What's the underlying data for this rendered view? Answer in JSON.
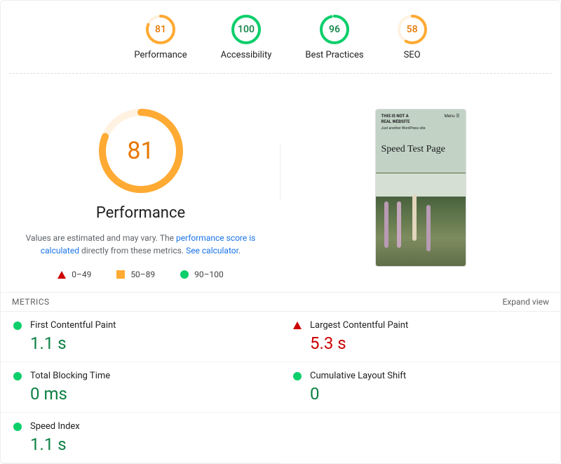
{
  "colors": {
    "fail": "#cc0000",
    "average": "#fa3",
    "pass": "#0cce6b",
    "averageText": "#c33300",
    "averageScore": "#e67700",
    "averageBg": "#fff7e6",
    "passBg": "#e6faef",
    "passText": "#0b8043"
  },
  "categories": [
    {
      "id": "performance",
      "label": "Performance",
      "score": 81,
      "level": "average"
    },
    {
      "id": "accessibility",
      "label": "Accessibility",
      "score": 100,
      "level": "pass"
    },
    {
      "id": "best-practices",
      "label": "Best Practices",
      "score": 96,
      "level": "pass"
    },
    {
      "id": "seo",
      "label": "SEO",
      "score": 58,
      "level": "average"
    }
  ],
  "performance": {
    "score": 81,
    "level": "average",
    "title": "Performance",
    "desc_pre": "Values are estimated and may vary. The ",
    "desc_link1": "performance score is calculated",
    "desc_mid": " directly from these metrics. ",
    "desc_link2": "See calculator",
    "desc_post": "."
  },
  "legend": {
    "fail": "0–49",
    "average": "50–89",
    "pass": "90–100"
  },
  "screenshot": {
    "headline1": "THIS IS NOT A",
    "headline2": "REAL WEBSITE",
    "tagline": "Just another WordPress site",
    "menu": "Menu ☰",
    "title": "Speed Test Page"
  },
  "metricsHeader": {
    "title": "METRICS",
    "expand": "Expand view"
  },
  "metrics": [
    {
      "id": "fcp",
      "label": "First Contentful Paint",
      "value": "1.1 s",
      "level": "pass"
    },
    {
      "id": "lcp",
      "label": "Largest Contentful Paint",
      "value": "5.3 s",
      "level": "fail"
    },
    {
      "id": "tbt",
      "label": "Total Blocking Time",
      "value": "0 ms",
      "level": "pass"
    },
    {
      "id": "cls",
      "label": "Cumulative Layout Shift",
      "value": "0",
      "level": "pass"
    },
    {
      "id": "si",
      "label": "Speed Index",
      "value": "1.1 s",
      "level": "pass"
    }
  ]
}
